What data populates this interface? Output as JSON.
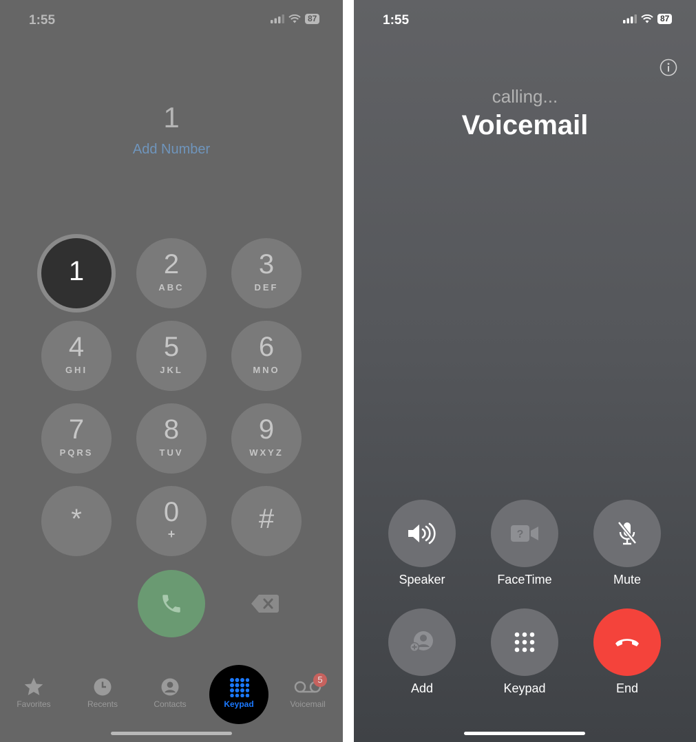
{
  "left": {
    "status": {
      "time": "1:55",
      "battery": "87"
    },
    "entered_number": "1",
    "add_number": "Add Number",
    "keys": [
      {
        "digit": "1",
        "letters": ""
      },
      {
        "digit": "2",
        "letters": "ABC"
      },
      {
        "digit": "3",
        "letters": "DEF"
      },
      {
        "digit": "4",
        "letters": "GHI"
      },
      {
        "digit": "5",
        "letters": "JKL"
      },
      {
        "digit": "6",
        "letters": "MNO"
      },
      {
        "digit": "7",
        "letters": "PQRS"
      },
      {
        "digit": "8",
        "letters": "TUV"
      },
      {
        "digit": "9",
        "letters": "WXYZ"
      },
      {
        "digit": "*",
        "letters": ""
      },
      {
        "digit": "0",
        "letters": "+"
      },
      {
        "digit": "#",
        "letters": ""
      }
    ],
    "tabs": [
      {
        "label": "Favorites",
        "icon": "star-icon"
      },
      {
        "label": "Recents",
        "icon": "clock-icon"
      },
      {
        "label": "Contacts",
        "icon": "person-icon"
      },
      {
        "label": "Keypad",
        "icon": "keypad-icon"
      },
      {
        "label": "Voicemail",
        "icon": "voicemail-icon",
        "badge": "5"
      }
    ],
    "colors": {
      "call": "#6a9a72",
      "active_tab": "#1b79ff"
    }
  },
  "right": {
    "status": {
      "time": "1:55",
      "battery": "87"
    },
    "calling": "calling...",
    "callee": "Voicemail",
    "buttons": [
      {
        "label": "Speaker",
        "icon": "speaker-icon"
      },
      {
        "label": "FaceTime",
        "icon": "facetime-icon"
      },
      {
        "label": "Mute",
        "icon": "mute-icon"
      },
      {
        "label": "Add",
        "icon": "add-contact-icon"
      },
      {
        "label": "Keypad",
        "icon": "keypad-icon"
      },
      {
        "label": "End",
        "icon": "end-call-icon"
      }
    ],
    "colors": {
      "end": "#f4433b"
    }
  }
}
